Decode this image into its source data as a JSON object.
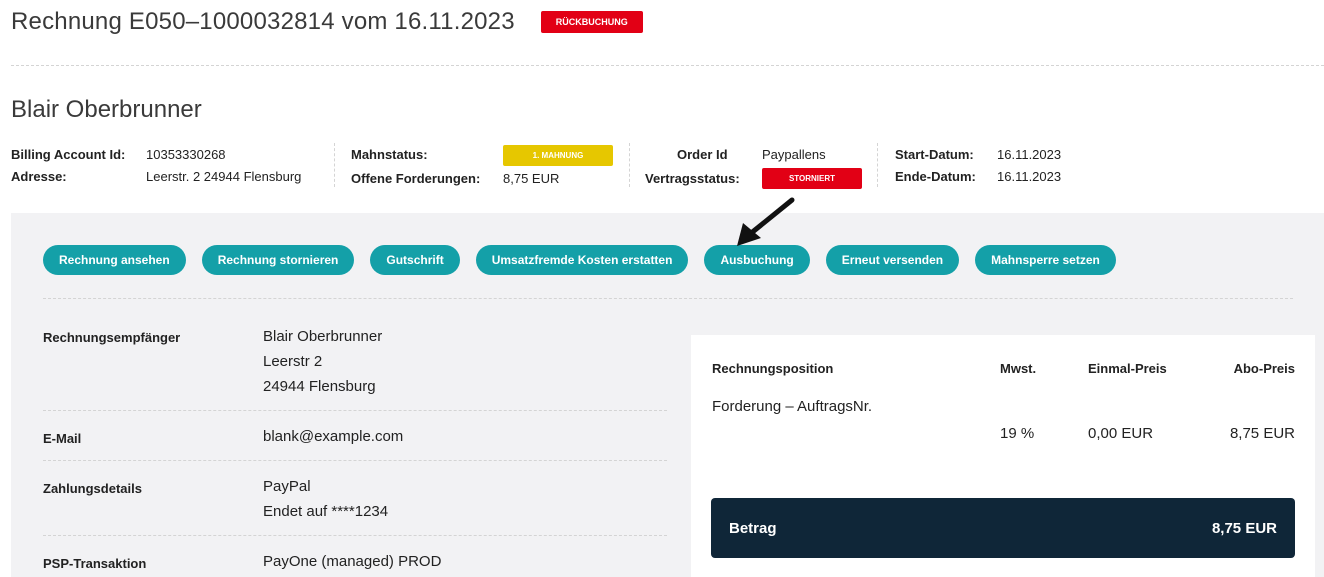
{
  "header": {
    "title": "Rechnung E050–1000032814 vom 16.11.2023",
    "status_badge": "RÜCKBUCHUNG"
  },
  "customer": {
    "name": "Blair Oberbrunner"
  },
  "info": {
    "billing_account_label": "Billing Account Id:",
    "billing_account_value": "10353330268",
    "address_label": "Adresse:",
    "address_value": "Leerstr. 2 24944 Flensburg",
    "dunning_label": "Mahnstatus:",
    "dunning_badge": "1. MAHNUNG",
    "open_claims_label": "Offene Forderungen:",
    "open_claims_value": "8,75 EUR",
    "order_id_label": "Order Id",
    "order_id_value": "Paypallens",
    "contract_status_label": "Vertragsstatus:",
    "contract_status_badge": "STORNIERT",
    "start_label": "Start-Datum:",
    "start_value": "16.11.2023",
    "end_label": "Ende-Datum:",
    "end_value": "16.11.2023"
  },
  "actions": [
    "Rechnung ansehen",
    "Rechnung stornieren",
    "Gutschrift",
    "Umsatzfremde Kosten erstatten",
    "Ausbuchung",
    "Erneut versenden",
    "Mahnsperre setzen"
  ],
  "details": {
    "recipient_label": "Rechnungsempfänger",
    "recipient_lines": [
      "Blair Oberbrunner",
      "Leerstr 2",
      "24944 Flensburg"
    ],
    "email_label": "E-Mail",
    "email_value": "blank@example.com",
    "payment_label": "Zahlungsdetails",
    "payment_lines": [
      "PayPal",
      "Endet auf ****1234"
    ],
    "psp_label": "PSP-Transaktion",
    "psp_value": "PayOne (managed) PROD"
  },
  "invoice": {
    "columns": [
      "Rechnungsposition",
      "Mwst.",
      "Einmal-Preis",
      "Abo-Preis"
    ],
    "rows": [
      {
        "position": "Forderung – AuftragsNr.",
        "vat": "19 %",
        "one_time": "0,00 EUR",
        "subscription": "8,75 EUR"
      }
    ],
    "total_label": "Betrag",
    "total_value": "8,75 EUR"
  },
  "colors": {
    "accent": "#14a0a8",
    "danger": "#e20015",
    "warning": "#e6c700",
    "total_bg": "#0f2638",
    "panel_bg": "#f2f2f4"
  }
}
